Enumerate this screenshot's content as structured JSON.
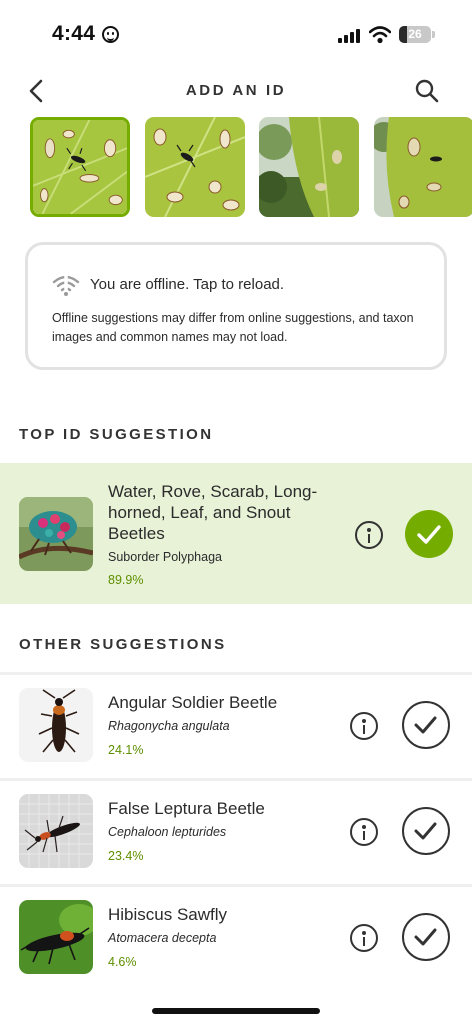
{
  "status_bar": {
    "time": "4:44",
    "battery": "26",
    "battery_level": 0.26
  },
  "header": {
    "title": "ADD AN ID",
    "back_icon": "chevron-left-icon",
    "search_icon": "search-icon"
  },
  "photos": [
    {
      "selected": true
    },
    {
      "selected": false
    },
    {
      "selected": false
    },
    {
      "selected": false
    }
  ],
  "offline": {
    "icon": "wifi-off-icon",
    "title": "You are offline. Tap to reload.",
    "body": "Offline suggestions may differ from online suggestions, and taxon images and common names may not load."
  },
  "top_section": {
    "heading": "TOP ID SUGGESTION",
    "item": {
      "name": "Water, Rove, Scarab, Long-horned, Leaf, and Snout Beetles",
      "scientific": "Suborder Polyphaga",
      "score": "89.9%"
    }
  },
  "other_section": {
    "heading": "OTHER SUGGESTIONS",
    "items": [
      {
        "name": "Angular Soldier Beetle",
        "scientific": "Rhagonycha angulata",
        "score": "24.1%"
      },
      {
        "name": "False Leptura Beetle",
        "scientific": "Cephaloon lepturides",
        "score": "23.4%"
      },
      {
        "name": "Hibiscus Sawfly",
        "scientific": "Atomacera decepta",
        "score": "4.6%"
      }
    ]
  },
  "colors": {
    "accent": "#74ac00",
    "score_green": "#5e8f00",
    "top_row_bg": "#e8f2d7"
  }
}
